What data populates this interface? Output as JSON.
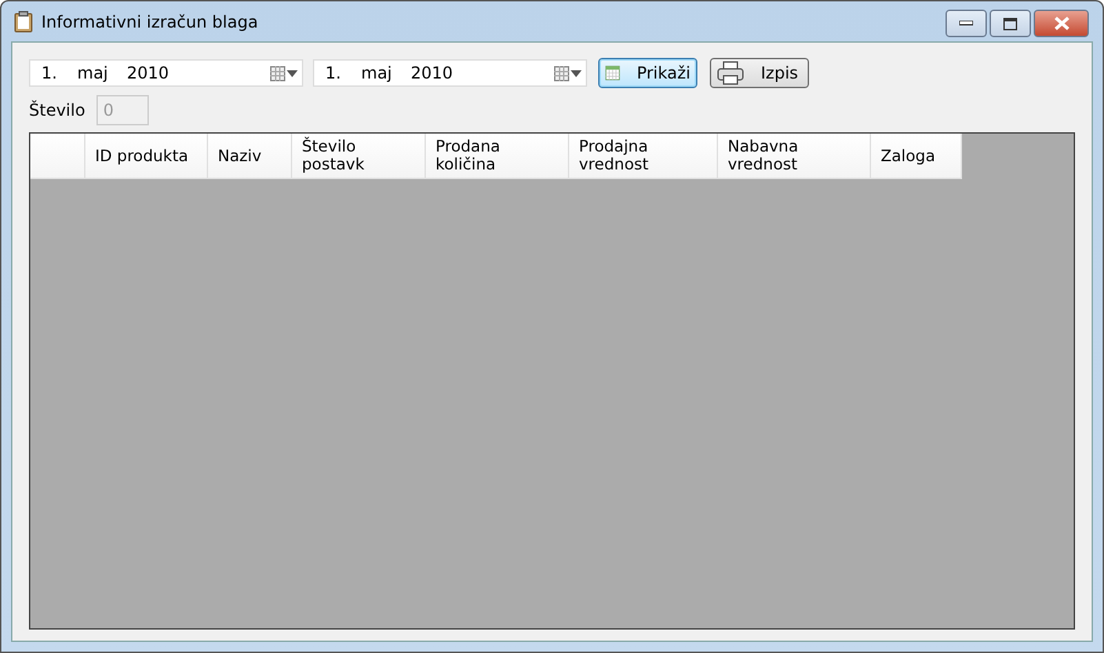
{
  "window": {
    "title": "Informativni izračun blaga"
  },
  "date_from": {
    "day": "1.",
    "month": "maj",
    "year": "2010"
  },
  "date_to": {
    "day": "1.",
    "month": "maj",
    "year": "2010"
  },
  "buttons": [
    {
      "kind": "calendar",
      "label": "Prikaži",
      "focused": true
    },
    {
      "kind": "printer",
      "label": "Izpis",
      "focused": false
    }
  ],
  "count": {
    "label": "Število",
    "value": "0",
    "disabled": true
  },
  "table": {
    "columns": [
      "ID produkta",
      "Naziv",
      "Število\npostavk",
      "Prodana\nkoličina",
      "Prodajna\nvrednost",
      "Nabavna\nvrednost",
      "Zaloga"
    ]
  }
}
